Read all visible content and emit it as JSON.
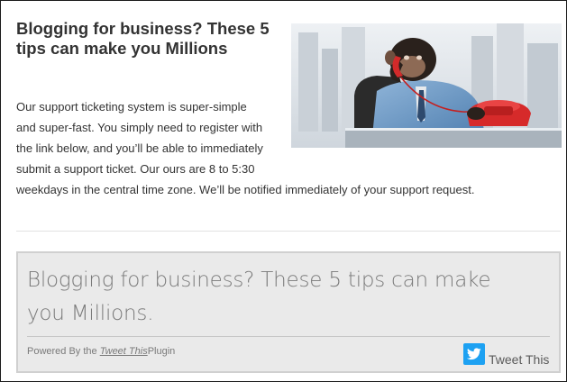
{
  "post": {
    "title": "Blogging for business? These 5 tips can make you Millions",
    "body": "Our support ticketing system is super-simple and super-fast. You simply need to register with the link below, and you’ll be able to immediately submit a support ticket. Our ours are 8 to 5:30 weekdays in the central time zone. We’ll be notified immediately of your support request.",
    "image_icon": "chimpanzee-on-phone-photo"
  },
  "tweet_box": {
    "text": "Blogging for business? These 5 tips can make you Millions.",
    "powered_prefix": "Powered By the",
    "powered_link": "Tweet This",
    "powered_suffix": "Plugin",
    "action_label": "Tweet This",
    "action_icon": "twitter-bird-icon"
  },
  "colors": {
    "twitter_blue": "#1da1f2",
    "tweet_box_bg": "#eaeaea",
    "tweet_box_border": "#d0d0d0",
    "body_text": "#333333"
  }
}
